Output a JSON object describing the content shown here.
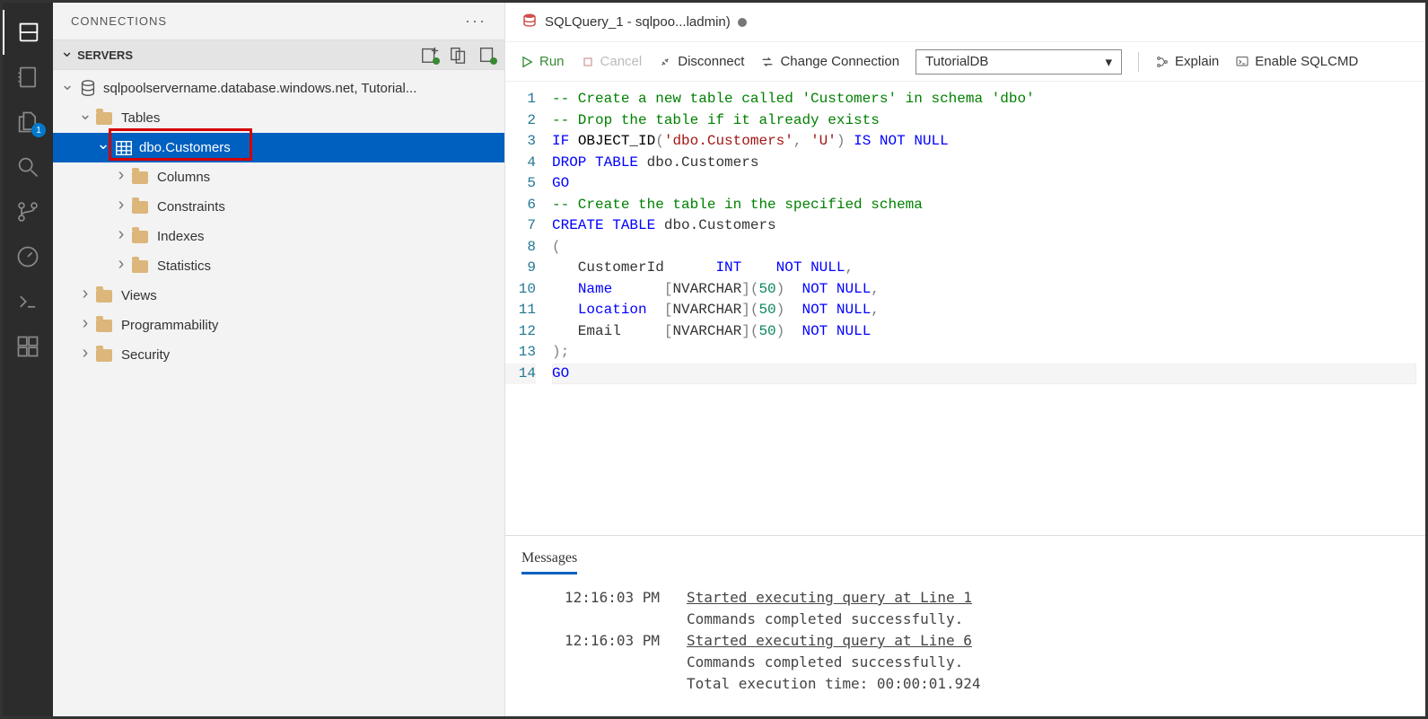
{
  "panel": {
    "title": "CONNECTIONS",
    "section_title": "SERVERS"
  },
  "tree": {
    "server": "sqlpoolservername.database.windows.net, Tutorial...",
    "tables": "Tables",
    "dbo_customers": "dbo.Customers",
    "columns": "Columns",
    "constraints": "Constraints",
    "indexes": "Indexes",
    "statistics": "Statistics",
    "views": "Views",
    "programmability": "Programmability",
    "security": "Security"
  },
  "activity_badge": "1",
  "tab": {
    "label": "SQLQuery_1 - sqlpoo...ladmin)"
  },
  "toolbar": {
    "run": "Run",
    "cancel": "Cancel",
    "disconnect": "Disconnect",
    "change_conn": "Change Connection",
    "explain": "Explain",
    "sqlcmd": "Enable SQLCMD",
    "db_selected": "TutorialDB"
  },
  "code": [
    [
      {
        "c": "tok-comment",
        "t": "-- Create a new table called 'Customers' in schema 'dbo'"
      }
    ],
    [
      {
        "c": "tok-comment",
        "t": "-- Drop the table if it already exists"
      }
    ],
    [
      {
        "c": "tok-kw",
        "t": "IF"
      },
      {
        "t": " "
      },
      {
        "c": "tok-fn",
        "t": "OBJECT_ID"
      },
      {
        "c": "tok-op",
        "t": "("
      },
      {
        "c": "tok-str",
        "t": "'dbo.Customers'"
      },
      {
        "c": "tok-op",
        "t": ", "
      },
      {
        "c": "tok-str",
        "t": "'U'"
      },
      {
        "c": "tok-op",
        "t": ")"
      },
      {
        "t": " "
      },
      {
        "c": "tok-kw",
        "t": "IS"
      },
      {
        "t": " "
      },
      {
        "c": "tok-kw",
        "t": "NOT"
      },
      {
        "t": " "
      },
      {
        "c": "tok-kw",
        "t": "NULL"
      }
    ],
    [
      {
        "c": "tok-kw",
        "t": "DROP"
      },
      {
        "t": " "
      },
      {
        "c": "tok-kw",
        "t": "TABLE"
      },
      {
        "t": " dbo.Customers"
      }
    ],
    [
      {
        "c": "tok-kw",
        "t": "GO"
      }
    ],
    [
      {
        "c": "tok-comment",
        "t": "-- Create the table in the specified schema"
      }
    ],
    [
      {
        "c": "tok-kw",
        "t": "CREATE"
      },
      {
        "t": " "
      },
      {
        "c": "tok-kw",
        "t": "TABLE"
      },
      {
        "t": " dbo.Customers"
      }
    ],
    [
      {
        "c": "tok-op",
        "t": "("
      }
    ],
    [
      {
        "t": "   CustomerId      "
      },
      {
        "c": "tok-type",
        "t": "INT"
      },
      {
        "t": "    "
      },
      {
        "c": "tok-kw",
        "t": "NOT"
      },
      {
        "t": " "
      },
      {
        "c": "tok-kw",
        "t": "NULL"
      },
      {
        "c": "tok-op",
        "t": ","
      }
    ],
    [
      {
        "t": "   "
      },
      {
        "c": "tok-type",
        "t": "Name"
      },
      {
        "t": "      "
      },
      {
        "c": "tok-op",
        "t": "["
      },
      {
        "t": "NVARCHAR"
      },
      {
        "c": "tok-op",
        "t": "]("
      },
      {
        "c": "tok-num",
        "t": "50"
      },
      {
        "c": "tok-op",
        "t": ")"
      },
      {
        "t": "  "
      },
      {
        "c": "tok-kw",
        "t": "NOT"
      },
      {
        "t": " "
      },
      {
        "c": "tok-kw",
        "t": "NULL"
      },
      {
        "c": "tok-op",
        "t": ","
      }
    ],
    [
      {
        "t": "   "
      },
      {
        "c": "tok-type",
        "t": "Location"
      },
      {
        "t": "  "
      },
      {
        "c": "tok-op",
        "t": "["
      },
      {
        "t": "NVARCHAR"
      },
      {
        "c": "tok-op",
        "t": "]("
      },
      {
        "c": "tok-num",
        "t": "50"
      },
      {
        "c": "tok-op",
        "t": ")"
      },
      {
        "t": "  "
      },
      {
        "c": "tok-kw",
        "t": "NOT"
      },
      {
        "t": " "
      },
      {
        "c": "tok-kw",
        "t": "NULL"
      },
      {
        "c": "tok-op",
        "t": ","
      }
    ],
    [
      {
        "t": "   Email     "
      },
      {
        "c": "tok-op",
        "t": "["
      },
      {
        "t": "NVARCHAR"
      },
      {
        "c": "tok-op",
        "t": "]("
      },
      {
        "c": "tok-num",
        "t": "50"
      },
      {
        "c": "tok-op",
        "t": ")"
      },
      {
        "t": "  "
      },
      {
        "c": "tok-kw",
        "t": "NOT"
      },
      {
        "t": " "
      },
      {
        "c": "tok-kw",
        "t": "NULL"
      }
    ],
    [
      {
        "c": "tok-op",
        "t": ");"
      }
    ],
    [
      {
        "c": "tok-kw",
        "t": "GO"
      }
    ]
  ],
  "messages": {
    "tab": "Messages",
    "entries": [
      {
        "time": "12:16:03 PM",
        "lines": [
          {
            "u": true,
            "t": "Started executing query at Line 1"
          },
          {
            "u": false,
            "t": "Commands completed successfully."
          }
        ]
      },
      {
        "time": "12:16:03 PM",
        "lines": [
          {
            "u": true,
            "t": "Started executing query at Line 6"
          },
          {
            "u": false,
            "t": "Commands completed successfully."
          },
          {
            "u": false,
            "t": "Total execution time: 00:00:01.924"
          }
        ]
      }
    ]
  }
}
